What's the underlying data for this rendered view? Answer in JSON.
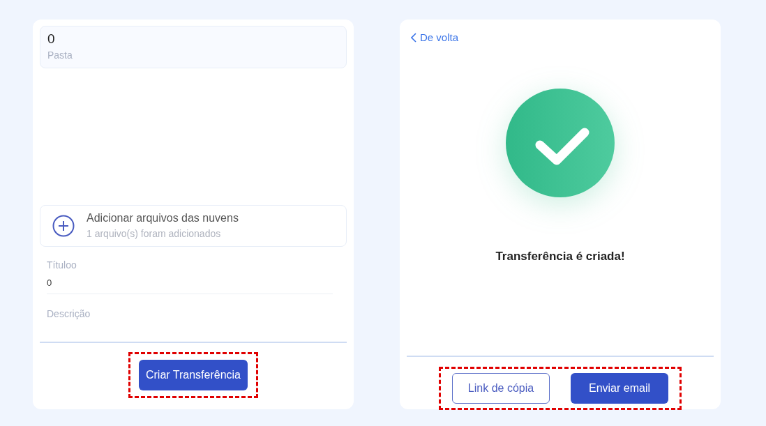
{
  "left_panel": {
    "folder": {
      "count": "0",
      "label": "Pasta"
    },
    "add_cloud": {
      "title": "Adicionar arquivos das nuvens",
      "subtitle": "1 arquivo(s) foram adicionados"
    },
    "title_field": {
      "label": "Títuloo",
      "value": "0"
    },
    "description_field": {
      "placeholder": "Descrição"
    },
    "button": "Criar Transferência"
  },
  "right_panel": {
    "back_link": "De volta",
    "message": "Transferência é criada!",
    "buttons": [
      {
        "label": "Link de cópia",
        "kind": "outline"
      },
      {
        "label": "Enviar email",
        "kind": "primary"
      }
    ]
  }
}
